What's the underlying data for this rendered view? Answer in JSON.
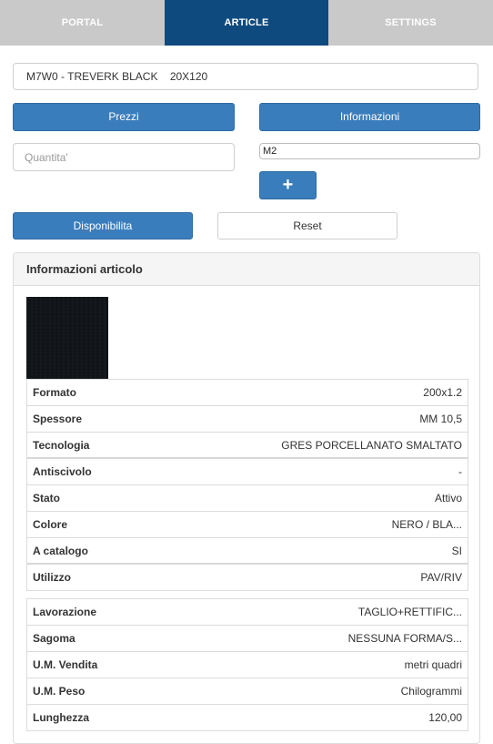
{
  "tabs": [
    {
      "label": "PORTAL",
      "active": false
    },
    {
      "label": "ARTICLE",
      "active": true
    },
    {
      "label": "SETTINGS",
      "active": false
    }
  ],
  "article": {
    "code_label": "M7W0 - TREVERK BLACK    20X120"
  },
  "buttons": {
    "prezzi": "Prezzi",
    "informazioni": "Informazioni",
    "plus": "+",
    "disponibilita": "Disponibilita",
    "reset": "Reset"
  },
  "quantity": {
    "placeholder": "Quantita'",
    "value": ""
  },
  "unit": {
    "value": "M2"
  },
  "panel": {
    "title": "Informazioni articolo",
    "specs": [
      {
        "label": "Formato",
        "value": "200x1.2"
      },
      {
        "label": "Spessore",
        "value": "MM 10,5"
      },
      {
        "label": "Tecnologia",
        "value": "GRES PORCELLANATO SMALTATO"
      },
      {
        "label": "Antiscivolo",
        "value": "-"
      },
      {
        "label": "Stato",
        "value": "Attivo"
      },
      {
        "label": "Colore",
        "value": "NERO / BLA..."
      },
      {
        "label": "A catalogo",
        "value": "SI"
      },
      {
        "label": "Utilizzo",
        "value": "PAV/RIV"
      }
    ],
    "details": [
      {
        "label": "Lavorazione",
        "value": "TAGLIO+RETTIFIC..."
      },
      {
        "label": "Sagoma",
        "value": "NESSUNA FORMA/S..."
      },
      {
        "label": "U.M. Vendita",
        "value": "metri quadri"
      },
      {
        "label": "U.M. Peso",
        "value": "Chilogrammi"
      },
      {
        "label": "Lunghezza",
        "value": "120,00"
      }
    ]
  },
  "colors": {
    "accent": "#3a7dbd",
    "tab_active": "#0f4a7e",
    "tab_bar": "#c9c9c9"
  }
}
